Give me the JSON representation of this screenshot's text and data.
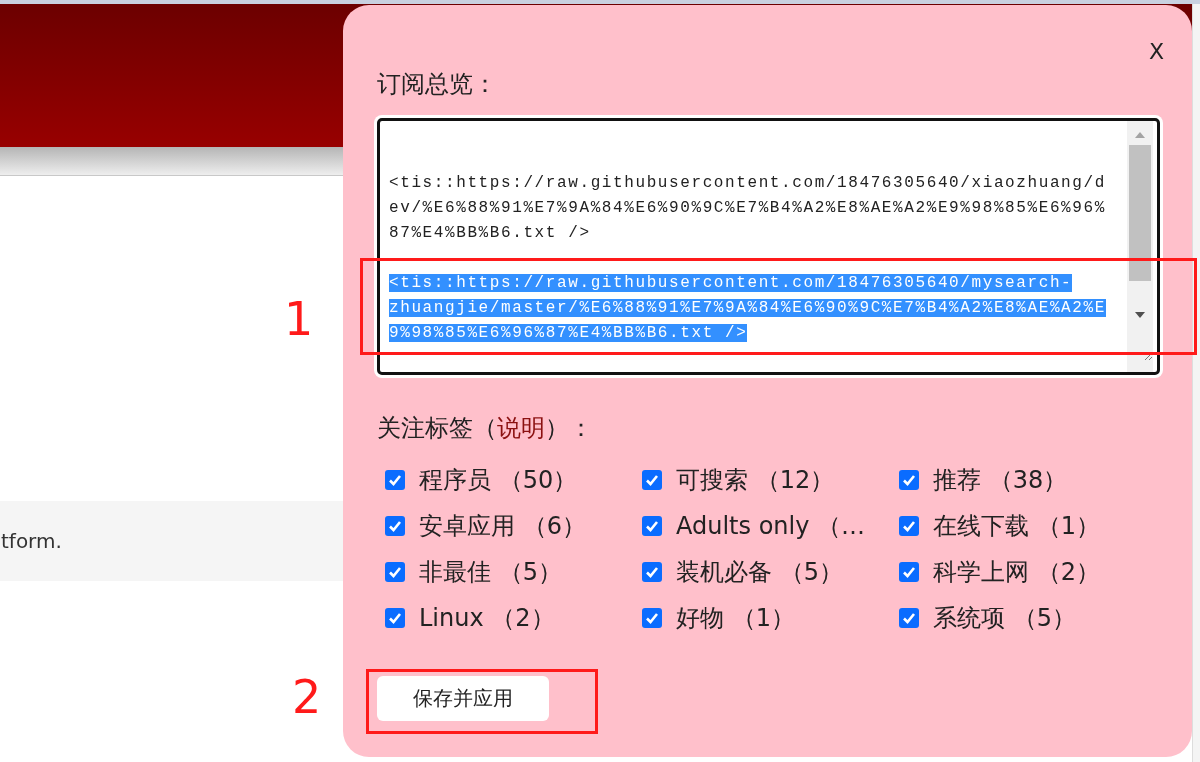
{
  "page": {
    "snippet": "tform."
  },
  "dialog": {
    "close": "X",
    "title": "订阅总览：",
    "subscriptions": [
      {
        "text": "<tis::https://raw.githubusercontent.com/18476305640/xiaozhuang/dev/%E6%88%91%E7%9A%84%E6%90%9C%E7%B4%A2%E8%AE%A2%E9%98%85%E6%96%87%E4%BB%B6.txt />",
        "selected": false
      },
      {
        "text": "<tis::https://raw.githubusercontent.com/18476305640/mysearch-zhuangjie/master/%E6%88%91%E7%9A%84%E6%90%9C%E7%B4%A2%E8%AE%A2%E9%98%85%E6%96%87%E4%BB%B6.txt />",
        "selected": true
      }
    ],
    "tags_heading": {
      "before": "关注标签（",
      "link": "说明",
      "after": "）："
    },
    "tags": [
      {
        "label": "程序员 （50）",
        "checked": true
      },
      {
        "label": "可搜索 （12）",
        "checked": true
      },
      {
        "label": "推荐 （38）",
        "checked": true
      },
      {
        "label": "安卓应用 （6）",
        "checked": true
      },
      {
        "label": "Adults only （…",
        "checked": true
      },
      {
        "label": "在线下载 （1）",
        "checked": true
      },
      {
        "label": "非最佳 （5）",
        "checked": true
      },
      {
        "label": "装机必备 （5）",
        "checked": true
      },
      {
        "label": "科学上网 （2）",
        "checked": true
      },
      {
        "label": "Linux （2）",
        "checked": true
      },
      {
        "label": "好物 （1）",
        "checked": true
      },
      {
        "label": "系统项 （5）",
        "checked": true
      }
    ],
    "save_button": "保存并应用"
  },
  "annotations": [
    {
      "label": "1"
    },
    {
      "label": "2"
    }
  ]
}
